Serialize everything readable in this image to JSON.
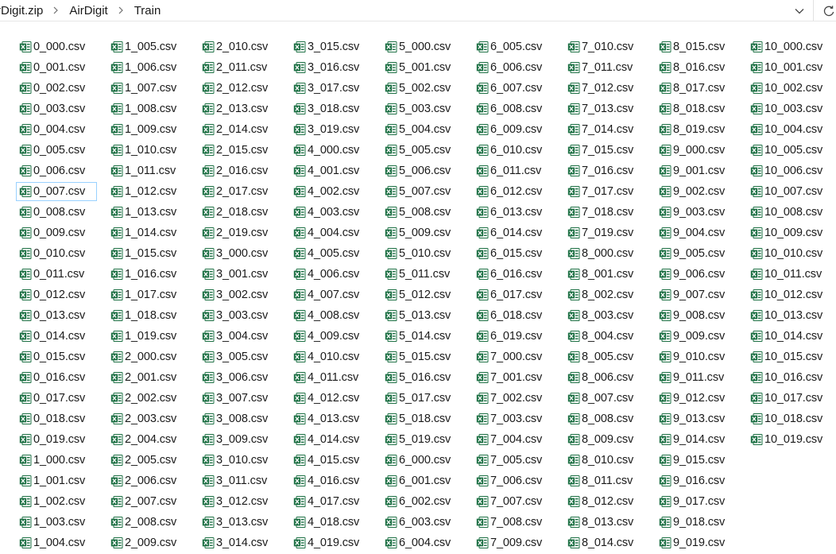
{
  "breadcrumb": {
    "items": [
      "rDigit.zip",
      "AirDigit",
      "Train"
    ]
  },
  "icons": {
    "file": "excel-csv-icon",
    "separator": "chevron-right-icon",
    "history": "chevron-down-icon",
    "refresh": "refresh-icon"
  },
  "colors": {
    "excel_green": "#1d7044",
    "focus_border": "#99d1ff"
  },
  "selected_file": "0_007.csv",
  "files": [
    [
      "0_000.csv",
      "0_001.csv",
      "0_002.csv",
      "0_003.csv",
      "0_004.csv",
      "0_005.csv",
      "0_006.csv",
      "0_007.csv",
      "0_008.csv",
      "0_009.csv",
      "0_010.csv",
      "0_011.csv",
      "0_012.csv",
      "0_013.csv",
      "0_014.csv",
      "0_015.csv",
      "0_016.csv",
      "0_017.csv",
      "0_018.csv",
      "0_019.csv",
      "1_000.csv",
      "1_001.csv",
      "1_002.csv",
      "1_003.csv",
      "1_004.csv"
    ],
    [
      "1_005.csv",
      "1_006.csv",
      "1_007.csv",
      "1_008.csv",
      "1_009.csv",
      "1_010.csv",
      "1_011.csv",
      "1_012.csv",
      "1_013.csv",
      "1_014.csv",
      "1_015.csv",
      "1_016.csv",
      "1_017.csv",
      "1_018.csv",
      "1_019.csv",
      "2_000.csv",
      "2_001.csv",
      "2_002.csv",
      "2_003.csv",
      "2_004.csv",
      "2_005.csv",
      "2_006.csv",
      "2_007.csv",
      "2_008.csv",
      "2_009.csv"
    ],
    [
      "2_010.csv",
      "2_011.csv",
      "2_012.csv",
      "2_013.csv",
      "2_014.csv",
      "2_015.csv",
      "2_016.csv",
      "2_017.csv",
      "2_018.csv",
      "2_019.csv",
      "3_000.csv",
      "3_001.csv",
      "3_002.csv",
      "3_003.csv",
      "3_004.csv",
      "3_005.csv",
      "3_006.csv",
      "3_007.csv",
      "3_008.csv",
      "3_009.csv",
      "3_010.csv",
      "3_011.csv",
      "3_012.csv",
      "3_013.csv",
      "3_014.csv"
    ],
    [
      "3_015.csv",
      "3_016.csv",
      "3_017.csv",
      "3_018.csv",
      "3_019.csv",
      "4_000.csv",
      "4_001.csv",
      "4_002.csv",
      "4_003.csv",
      "4_004.csv",
      "4_005.csv",
      "4_006.csv",
      "4_007.csv",
      "4_008.csv",
      "4_009.csv",
      "4_010.csv",
      "4_011.csv",
      "4_012.csv",
      "4_013.csv",
      "4_014.csv",
      "4_015.csv",
      "4_016.csv",
      "4_017.csv",
      "4_018.csv",
      "4_019.csv"
    ],
    [
      "5_000.csv",
      "5_001.csv",
      "5_002.csv",
      "5_003.csv",
      "5_004.csv",
      "5_005.csv",
      "5_006.csv",
      "5_007.csv",
      "5_008.csv",
      "5_009.csv",
      "5_010.csv",
      "5_011.csv",
      "5_012.csv",
      "5_013.csv",
      "5_014.csv",
      "5_015.csv",
      "5_016.csv",
      "5_017.csv",
      "5_018.csv",
      "5_019.csv",
      "6_000.csv",
      "6_001.csv",
      "6_002.csv",
      "6_003.csv",
      "6_004.csv"
    ],
    [
      "6_005.csv",
      "6_006.csv",
      "6_007.csv",
      "6_008.csv",
      "6_009.csv",
      "6_010.csv",
      "6_011.csv",
      "6_012.csv",
      "6_013.csv",
      "6_014.csv",
      "6_015.csv",
      "6_016.csv",
      "6_017.csv",
      "6_018.csv",
      "6_019.csv",
      "7_000.csv",
      "7_001.csv",
      "7_002.csv",
      "7_003.csv",
      "7_004.csv",
      "7_005.csv",
      "7_006.csv",
      "7_007.csv",
      "7_008.csv",
      "7_009.csv"
    ],
    [
      "7_010.csv",
      "7_011.csv",
      "7_012.csv",
      "7_013.csv",
      "7_014.csv",
      "7_015.csv",
      "7_016.csv",
      "7_017.csv",
      "7_018.csv",
      "7_019.csv",
      "8_000.csv",
      "8_001.csv",
      "8_002.csv",
      "8_003.csv",
      "8_004.csv",
      "8_005.csv",
      "8_006.csv",
      "8_007.csv",
      "8_008.csv",
      "8_009.csv",
      "8_010.csv",
      "8_011.csv",
      "8_012.csv",
      "8_013.csv",
      "8_014.csv"
    ],
    [
      "8_015.csv",
      "8_016.csv",
      "8_017.csv",
      "8_018.csv",
      "8_019.csv",
      "9_000.csv",
      "9_001.csv",
      "9_002.csv",
      "9_003.csv",
      "9_004.csv",
      "9_005.csv",
      "9_006.csv",
      "9_007.csv",
      "9_008.csv",
      "9_009.csv",
      "9_010.csv",
      "9_011.csv",
      "9_012.csv",
      "9_013.csv",
      "9_014.csv",
      "9_015.csv",
      "9_016.csv",
      "9_017.csv",
      "9_018.csv",
      "9_019.csv"
    ],
    [
      "10_000.csv",
      "10_001.csv",
      "10_002.csv",
      "10_003.csv",
      "10_004.csv",
      "10_005.csv",
      "10_006.csv",
      "10_007.csv",
      "10_008.csv",
      "10_009.csv",
      "10_010.csv",
      "10_011.csv",
      "10_012.csv",
      "10_013.csv",
      "10_014.csv",
      "10_015.csv",
      "10_016.csv",
      "10_017.csv",
      "10_018.csv",
      "10_019.csv"
    ]
  ]
}
